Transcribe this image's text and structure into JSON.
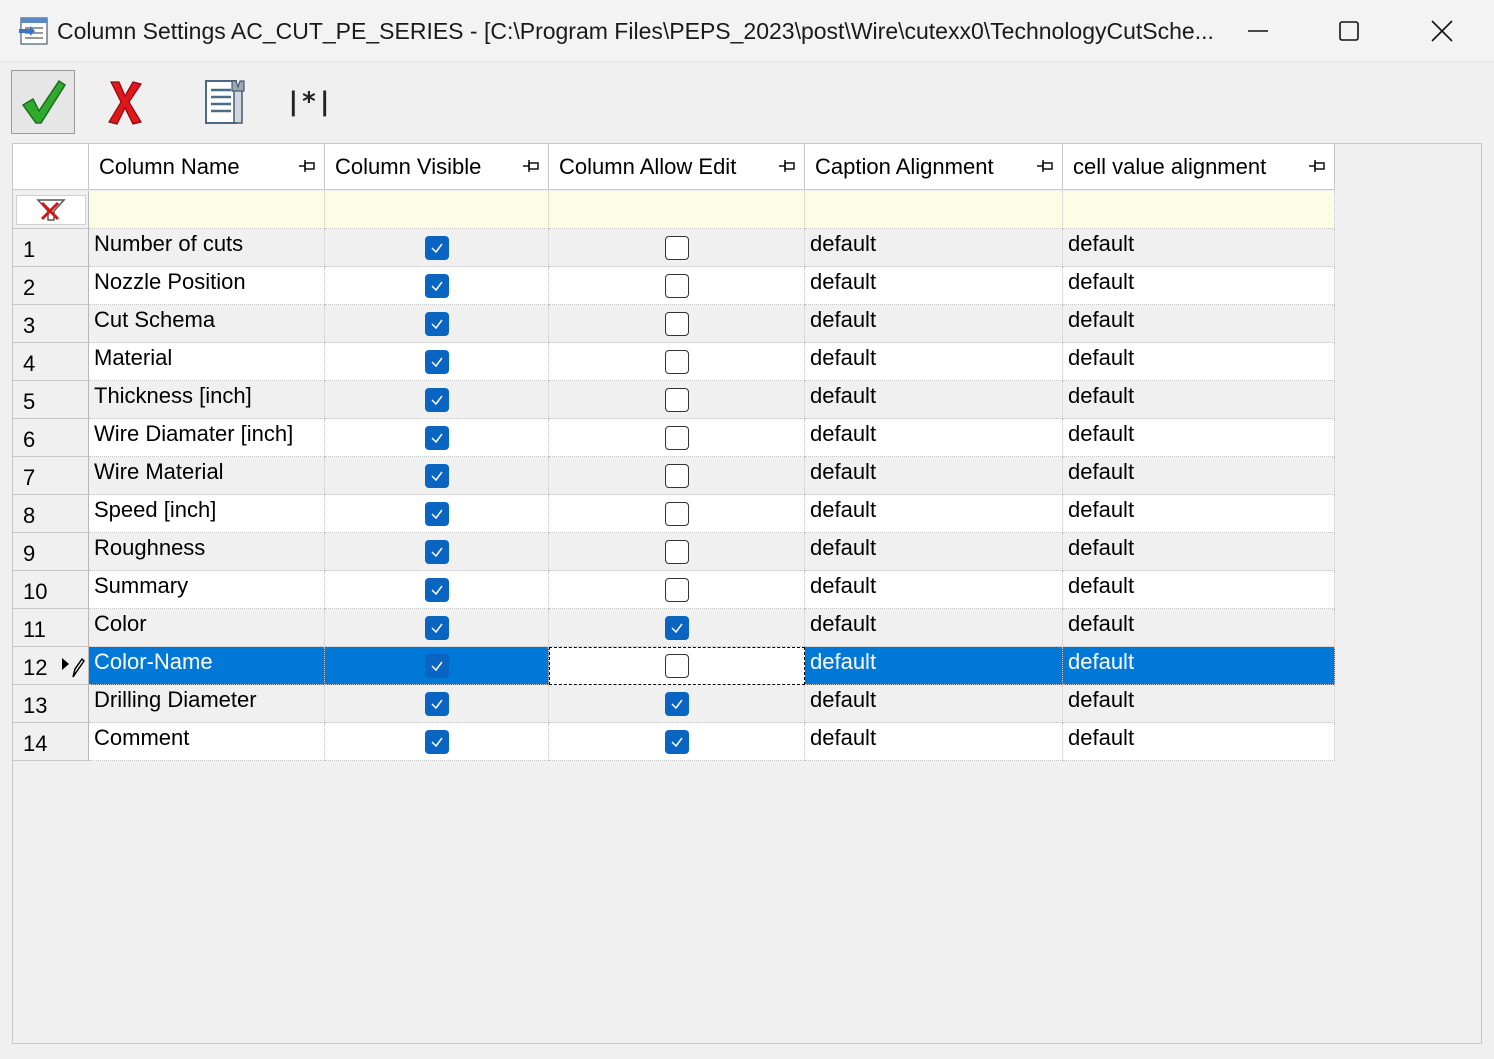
{
  "window": {
    "title": "Column Settings AC_CUT_PE_SERIES - [C:\\Program Files\\PEPS_2023\\post\\Wire\\cutexx0\\TechnologyCutSche...",
    "minimize_glyph": "—",
    "maximize_glyph": "☐",
    "close_glyph": "✕"
  },
  "toolbar": {
    "ok_icon": "green-check-icon",
    "cancel_icon": "red-x-icon",
    "settings_icon": "settings-tool-icon",
    "wildcard_label": "|*|"
  },
  "grid": {
    "columns": [
      "Column Name",
      "Column Visible",
      "Column Allow Edit",
      "Caption Alignment",
      "cell value alignment"
    ],
    "pin_glyph": "⊣",
    "selected_row": 12,
    "rows": [
      {
        "num": "1",
        "name": "Number of cuts",
        "visible": true,
        "edit": false,
        "caption": "default",
        "cell": "default"
      },
      {
        "num": "2",
        "name": "Nozzle Position",
        "visible": true,
        "edit": false,
        "caption": "default",
        "cell": "default"
      },
      {
        "num": "3",
        "name": "Cut Schema",
        "visible": true,
        "edit": false,
        "caption": "default",
        "cell": "default"
      },
      {
        "num": "4",
        "name": "Material",
        "visible": true,
        "edit": false,
        "caption": "default",
        "cell": "default"
      },
      {
        "num": "5",
        "name": "Thickness [inch]",
        "visible": true,
        "edit": false,
        "caption": "default",
        "cell": "default"
      },
      {
        "num": "6",
        "name": "Wire Diamater [inch]",
        "visible": true,
        "edit": false,
        "caption": "default",
        "cell": "default"
      },
      {
        "num": "7",
        "name": "Wire Material",
        "visible": true,
        "edit": false,
        "caption": "default",
        "cell": "default"
      },
      {
        "num": "8",
        "name": "Speed [inch]",
        "visible": true,
        "edit": false,
        "caption": "default",
        "cell": "default"
      },
      {
        "num": "9",
        "name": "Roughness",
        "visible": true,
        "edit": false,
        "caption": "default",
        "cell": "default"
      },
      {
        "num": "10",
        "name": "Summary",
        "visible": true,
        "edit": false,
        "caption": "default",
        "cell": "default"
      },
      {
        "num": "11",
        "name": "Color",
        "visible": true,
        "edit": true,
        "caption": "default",
        "cell": "default"
      },
      {
        "num": "12",
        "name": "Color-Name",
        "visible": true,
        "edit": false,
        "caption": "default",
        "cell": "default"
      },
      {
        "num": "13",
        "name": "Drilling Diameter",
        "visible": true,
        "edit": true,
        "caption": "default",
        "cell": "default"
      },
      {
        "num": "14",
        "name": "Comment",
        "visible": true,
        "edit": true,
        "caption": "default",
        "cell": "default"
      }
    ]
  },
  "colors": {
    "selection": "#0078d7",
    "checkbox_checked": "#0a64c2",
    "filter_row": "#fdfde6"
  }
}
